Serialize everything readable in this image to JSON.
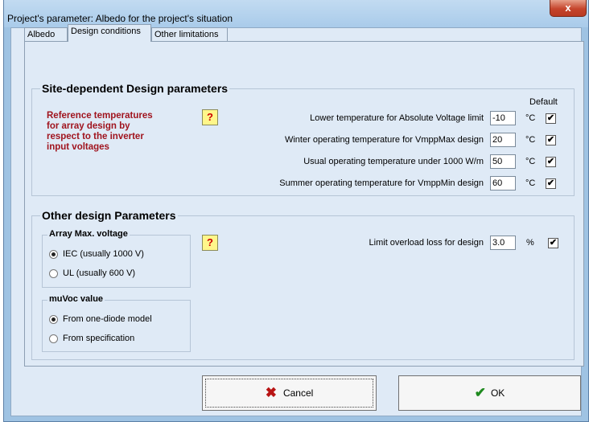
{
  "window": {
    "title": "Project's parameter: Albedo for the project's situation",
    "close_label": "x"
  },
  "tabs": [
    "Albedo",
    "Design conditions",
    "Other limitations"
  ],
  "site_params": {
    "title": "Site-dependent Design parameters",
    "reference_text": [
      "Reference temperatures",
      "for array design by",
      "respect to the inverter",
      "input voltages"
    ],
    "help_label": "?",
    "default_header": "Default",
    "rows": [
      {
        "label": "Lower temperature for Absolute Voltage  limit",
        "value": "-10",
        "unit": "°C",
        "default": true
      },
      {
        "label": "Winter operating temperature for VmppMax design",
        "value": "20",
        "unit": "°C",
        "default": true
      },
      {
        "label": "Usual operating temperature under 1000 W/m",
        "value": "50",
        "unit": "°C",
        "default": true
      },
      {
        "label": "Summer operating temperature for VmppMin design",
        "value": "60",
        "unit": "°C",
        "default": true
      }
    ]
  },
  "other_params": {
    "title": "Other design Parameters",
    "array_voltage": {
      "title": "Array Max. voltage",
      "options": [
        "IEC  (usually 1000 V)",
        "UL  (usually 600 V)"
      ],
      "selected": 0
    },
    "muvoc": {
      "title": "muVoc value",
      "options": [
        "From one-diode model",
        "From specification"
      ],
      "selected": 0
    },
    "help_label": "?",
    "overload": {
      "label": "Limit overload loss for design",
      "value": "3.0",
      "unit": "%",
      "checked": true
    }
  },
  "buttons": {
    "cancel": "Cancel",
    "ok": "OK"
  },
  "icons": {
    "check_mark": "✔",
    "cancel_mark": "✖"
  }
}
